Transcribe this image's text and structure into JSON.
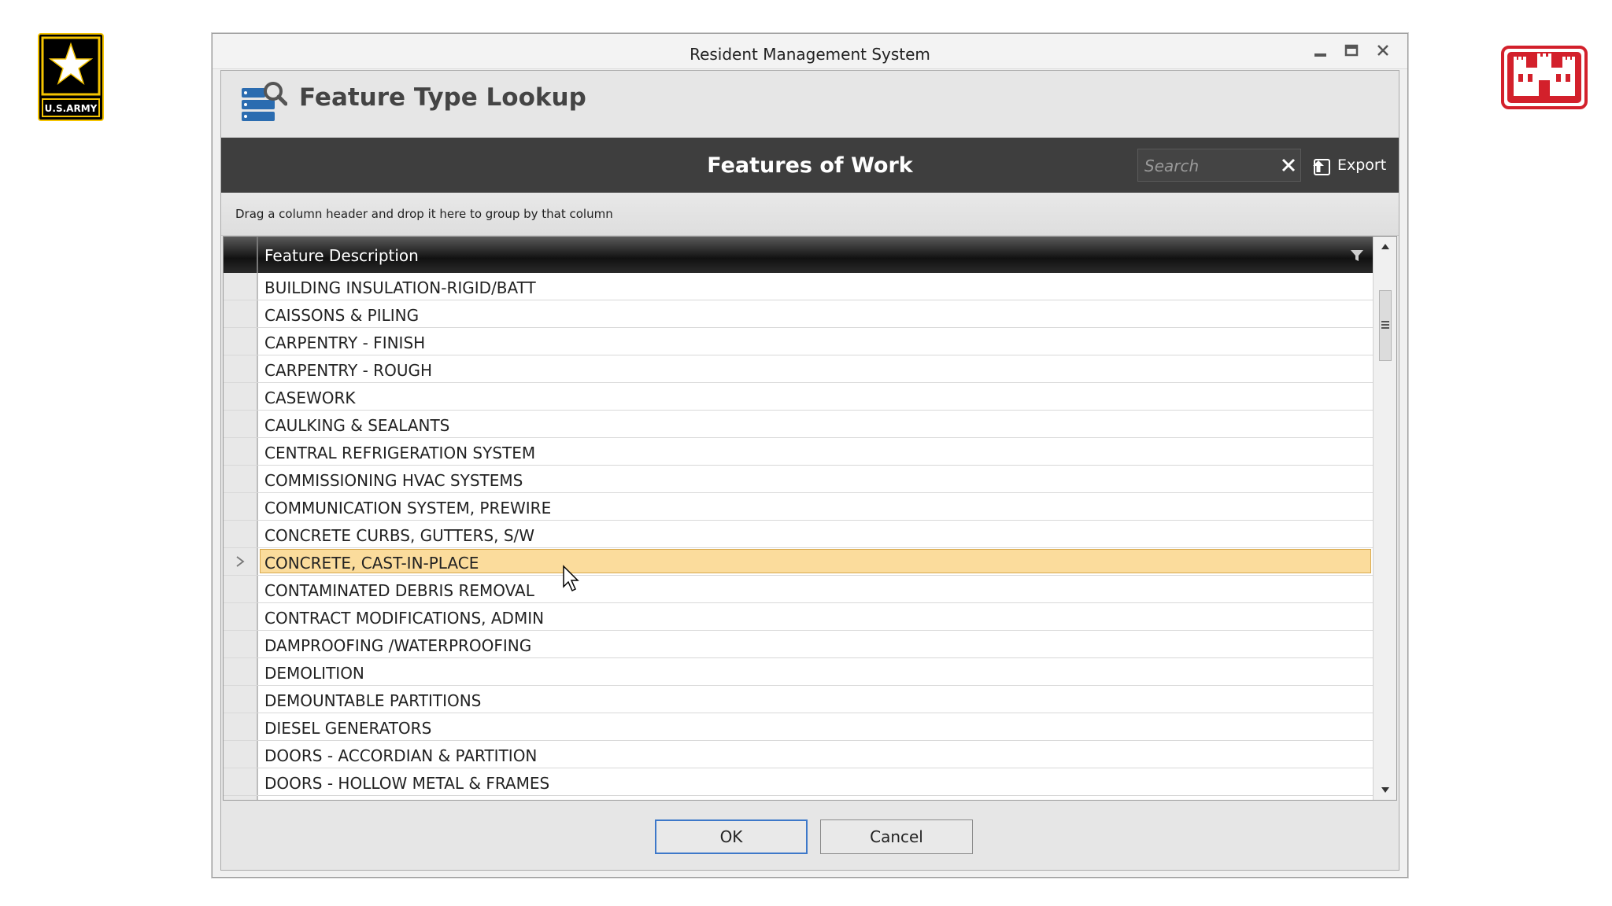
{
  "logos": {
    "army_text": "U.S.ARMY"
  },
  "window": {
    "title": "Resident Management System"
  },
  "lookup": {
    "title": "Feature Type Lookup"
  },
  "toolbar": {
    "title": "Features of Work",
    "search_placeholder": "Search",
    "export_label": "Export"
  },
  "group_panel": {
    "hint": "Drag a column header and drop it here to group by that column"
  },
  "grid": {
    "column_header": "Feature Description",
    "rows": [
      {
        "description": "BUILDING INSULATION-RIGID/BATT"
      },
      {
        "description": "CAISSONS & PILING"
      },
      {
        "description": "CARPENTRY - FINISH"
      },
      {
        "description": "CARPENTRY - ROUGH"
      },
      {
        "description": "CASEWORK"
      },
      {
        "description": "CAULKING & SEALANTS"
      },
      {
        "description": "CENTRAL REFRIGERATION SYSTEM"
      },
      {
        "description": "COMMISSIONING HVAC SYSTEMS"
      },
      {
        "description": "COMMUNICATION SYSTEM, PREWIRE"
      },
      {
        "description": "CONCRETE CURBS, GUTTERS, S/W"
      },
      {
        "description": "CONCRETE, CAST-IN-PLACE"
      },
      {
        "description": "CONTAMINATED DEBRIS REMOVAL"
      },
      {
        "description": "CONTRACT MODIFICATIONS, ADMIN"
      },
      {
        "description": "DAMPROOFING /WATERPROOFING"
      },
      {
        "description": "DEMOLITION"
      },
      {
        "description": "DEMOUNTABLE PARTITIONS"
      },
      {
        "description": "DIESEL GENERATORS"
      },
      {
        "description": "DOORS - ACCORDIAN & PARTITION"
      },
      {
        "description": "DOORS - HOLLOW METAL & FRAMES"
      },
      {
        "description": ""
      }
    ],
    "selected_index": 10
  },
  "footer": {
    "ok_label": "OK",
    "cancel_label": "Cancel"
  },
  "colors": {
    "toolbar_bg": "#3e3e3e",
    "selected_row_bg": "#fbdc9c",
    "army_gold": "#f5c400",
    "castle_red": "#d3202b",
    "ok_border": "#3d78c9"
  },
  "icons": {
    "window_controls": [
      "minimize-icon",
      "maximize-icon",
      "close-icon"
    ],
    "lookup": "database-search-icon",
    "search_clear": "close-icon",
    "export": "export-icon",
    "filter": "filter-icon",
    "row_current": "chevron-right-icon"
  }
}
